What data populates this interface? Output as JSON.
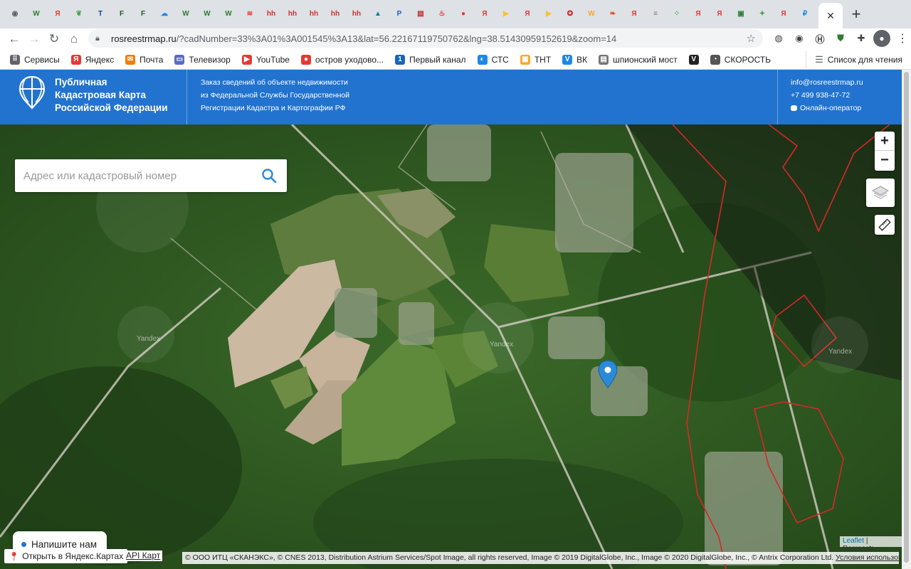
{
  "browser": {
    "tabs": [
      {
        "icon": "globe-icon",
        "glyph": "◉",
        "color": "#5f6368"
      },
      {
        "icon": "wb-icon",
        "glyph": "W",
        "color": "#2e7d32"
      },
      {
        "icon": "yandex-icon",
        "glyph": "Я",
        "color": "#e53935"
      },
      {
        "icon": "leaf-icon",
        "glyph": "❦",
        "color": "#43a047"
      },
      {
        "icon": "t-icon",
        "glyph": "T",
        "color": "#0d47a1"
      },
      {
        "icon": "f-icon",
        "glyph": "F",
        "color": "#1b5e20"
      },
      {
        "icon": "f-icon",
        "glyph": "F",
        "color": "#1b5e20"
      },
      {
        "icon": "cloud-icon",
        "glyph": "☁",
        "color": "#1e88e5"
      },
      {
        "icon": "wb-icon",
        "glyph": "W",
        "color": "#2e7d32"
      },
      {
        "icon": "wb-icon",
        "glyph": "W",
        "color": "#2e7d32"
      },
      {
        "icon": "wb-icon",
        "glyph": "W",
        "color": "#2e7d32"
      },
      {
        "icon": "layers-icon",
        "glyph": "≋",
        "color": "#e53935"
      },
      {
        "icon": "hh-icon",
        "glyph": "hh",
        "color": "#d32f2f"
      },
      {
        "icon": "hh-icon",
        "glyph": "hh",
        "color": "#d32f2f"
      },
      {
        "icon": "hh-icon",
        "glyph": "hh",
        "color": "#d32f2f"
      },
      {
        "icon": "hh-icon",
        "glyph": "hh",
        "color": "#d32f2f"
      },
      {
        "icon": "hh-icon",
        "glyph": "hh",
        "color": "#d32f2f"
      },
      {
        "icon": "triangle-icon",
        "glyph": "▲",
        "color": "#00838f"
      },
      {
        "icon": "p-icon",
        "glyph": "P",
        "color": "#1565c0"
      },
      {
        "icon": "book-icon",
        "glyph": "▤",
        "color": "#c62828"
      },
      {
        "icon": "fire-icon",
        "glyph": "♨",
        "color": "#e53935"
      },
      {
        "icon": "pin-icon",
        "glyph": "●",
        "color": "#e53935"
      },
      {
        "icon": "yandex-icon",
        "glyph": "Я",
        "color": "#e53935"
      },
      {
        "icon": "play-icon",
        "glyph": "▶",
        "color": "#fbc02d"
      },
      {
        "icon": "yandex-icon",
        "glyph": "Я",
        "color": "#e53935"
      },
      {
        "icon": "play-icon",
        "glyph": "▶",
        "color": "#fbc02d"
      },
      {
        "icon": "emblem-icon",
        "glyph": "✪",
        "color": "#c62828"
      },
      {
        "icon": "w-icon",
        "glyph": "W",
        "color": "#f9a825"
      },
      {
        "icon": "pepper-icon",
        "glyph": "❧",
        "color": "#e64a19"
      },
      {
        "icon": "yandex-icon",
        "glyph": "Я",
        "color": "#e53935"
      },
      {
        "icon": "car-icon",
        "glyph": "≡",
        "color": "#8d6e63"
      },
      {
        "icon": "dots-icon",
        "glyph": "⁘",
        "color": "#43a047"
      },
      {
        "icon": "yandex-icon",
        "glyph": "Я",
        "color": "#e53935"
      },
      {
        "icon": "yandex-icon",
        "glyph": "Я",
        "color": "#e53935"
      },
      {
        "icon": "map-icon",
        "glyph": "▣",
        "color": "#2e7d32"
      },
      {
        "icon": "arrow-icon",
        "glyph": "✦",
        "color": "#43a047"
      },
      {
        "icon": "yandex-icon",
        "glyph": "Я",
        "color": "#e53935"
      },
      {
        "icon": "rosreestr-icon",
        "glyph": "₽",
        "color": "#1e88e5"
      }
    ],
    "active_tab_close": "✕",
    "new_tab": "+",
    "url_host": "rosreestrmap.ru",
    "url_rest": "/?cadNumber=33%3A01%3A001545%3A13&lat=56.22167119750762&lng=38.51430959152619&zoom=14",
    "bookmarks": [
      {
        "label": "Сервисы",
        "icon": "apps-grid-icon",
        "glyph": "⠿",
        "color": "#5f6368"
      },
      {
        "label": "Яндекс",
        "icon": "yandex-icon",
        "glyph": "Я",
        "color": "#e53935"
      },
      {
        "label": "Почта",
        "icon": "mail-icon",
        "glyph": "✉",
        "color": "#f57c00"
      },
      {
        "label": "Телевизор",
        "icon": "tv-icon",
        "glyph": "▭",
        "color": "#5c6bc0"
      },
      {
        "label": "YouTube",
        "icon": "youtube-icon",
        "glyph": "▶",
        "color": "#e53935"
      },
      {
        "label": "остров уходово...",
        "icon": "map-pin-icon",
        "glyph": "●",
        "color": "#e53935"
      },
      {
        "label": "Первый канал",
        "icon": "channel-one-icon",
        "glyph": "1",
        "color": "#1565c0"
      },
      {
        "label": "СТС",
        "icon": "sts-icon",
        "glyph": "◐",
        "color": "#1e88e5"
      },
      {
        "label": "ТНТ",
        "icon": "tnt-icon",
        "glyph": "▦",
        "color": "#f9a825"
      },
      {
        "label": "ВК",
        "icon": "vk-icon",
        "glyph": "V",
        "color": "#1e88e5"
      },
      {
        "label": "шпионский мост",
        "icon": "bookmark-page-icon",
        "glyph": "▤",
        "color": "#757575"
      },
      {
        "label": "",
        "icon": "v-icon",
        "glyph": "V",
        "color": "#222222"
      },
      {
        "label": "СКОРОСТЬ",
        "icon": "speedometer-icon",
        "glyph": "◔",
        "color": "#555555"
      }
    ],
    "reading_list": "Список для чтения"
  },
  "site": {
    "brand_line1": "Публичная",
    "brand_line2": "Кадастровая Карта",
    "brand_line3": "Российской Федерации",
    "desc_line1": "Заказ сведений об объекте недвижимости",
    "desc_line2": "из Федеральной Службы Государственной",
    "desc_line3": "Регистрации Кадастра и Картографии РФ",
    "email": "info@rosreestrmap.ru",
    "phone": "+7 499 938-47-72",
    "operator": "Онлайн-оператор",
    "header_color": "#2173cf"
  },
  "map": {
    "search_placeholder": "Адрес или кадастровый номер",
    "zoom_in": "+",
    "zoom_out": "−",
    "yandex_watermark": "Yandex",
    "chat_button": "Напишите нам",
    "open_yandex": "Открыть в Яндекс.Картах",
    "api_link": "API Карт",
    "leaflet": "Leaflet",
    "attr_sep": "|",
    "rosreestr": "Rosreestr",
    "copyright": "© ООО ИТЦ «СКАНЭКС», © CNES 2013, Distribution Astrium Services/Spot Image, all rights reserved, Image © 2019 DigitalGlobe, Inc., Image © 2020 DigitalGlobe, Inc., © Antrix Corporation Ltd.",
    "terms": "Условия использования",
    "marker_color": "#2b8ad8",
    "parcel_color": "#d62828"
  }
}
